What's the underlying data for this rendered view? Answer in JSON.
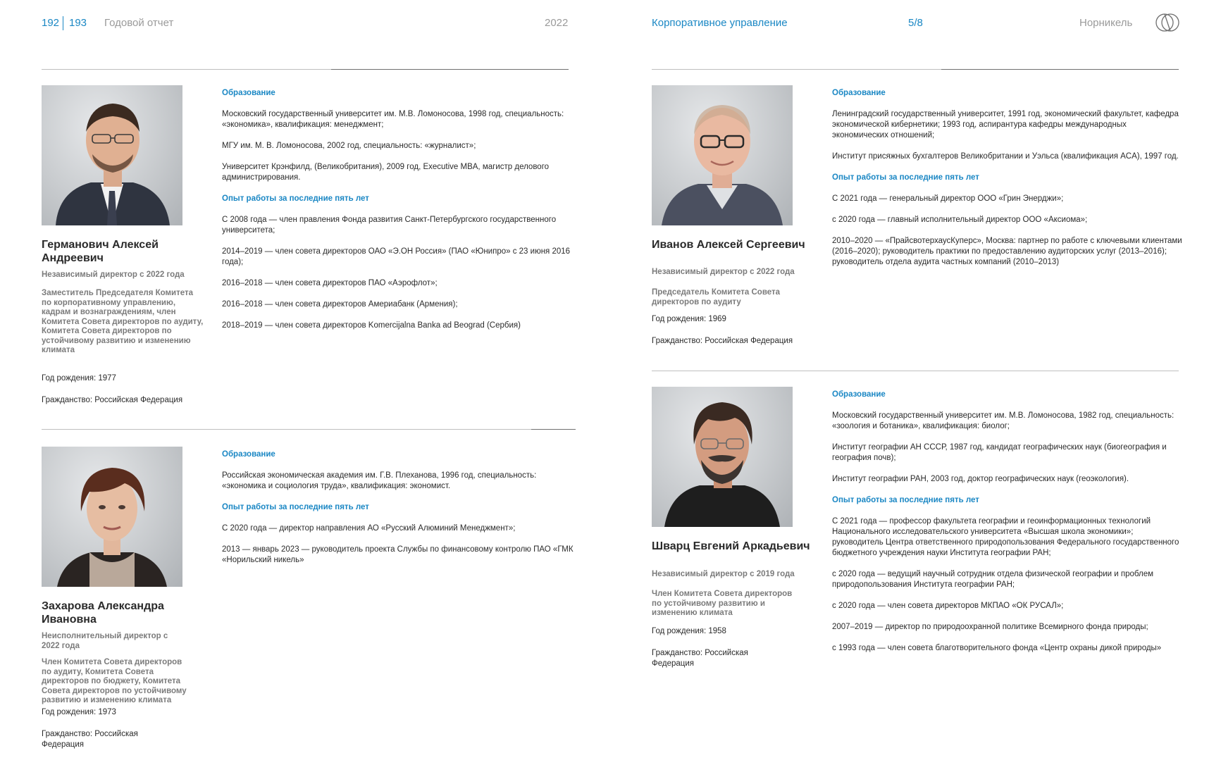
{
  "header": {
    "page_left": "192",
    "page_right": "193",
    "report_title": "Годовой отчет",
    "year": "2022",
    "section": "Корпоративное управление",
    "section_progress": "5/8",
    "company": "Норникель",
    "logo_icon": "nornickel-logo-icon"
  },
  "colors": {
    "accent": "#1a87c4",
    "text": "#2a2a2a",
    "muted": "#7b7b7b",
    "header_muted": "#9a9a9a"
  },
  "directors": [
    {
      "name": "Германович Алексей Андреевич",
      "role": "Независимый директор с 2022 года",
      "committees": "Заместитель Председателя Комитета по корпоративному управлению, кадрам и вознаграждениям, член Комитета Совета директоров по аудиту, Комитета Совета директоров по устойчивому развитию и изменению климата",
      "birth": "Год рождения: 1977",
      "citizenship": "Гражданство: Российская Федерация",
      "education_heading": "Образование",
      "education": [
        "Московский государственный университет им. М.В. Ломоносова, 1998 год, специальность: «экономика», квалификация: менеджмент;",
        "МГУ им. М. В. Ломоносова, 2002 год, специальность: «журналист»;",
        "Университет Крэнфилд, (Великобритания), 2009 год, Executive MBA, магистр делового администрирования."
      ],
      "experience_heading": "Опыт работы за последние пять лет",
      "experience": [
        "С 2008 года — член правления Фонда развития Санкт-Петербургского государственного университета;",
        "2014–2019 — член совета директоров ОАО «Э.ОН Россия» (ПАО «Юнипро» с 23 июня 2016 года);",
        "2016–2018 — член совета директоров ПАО «Аэрофлот»;",
        "2016–2018 — член совета директоров Америабанк (Армения);",
        "2018–2019 — член совета директоров Komercijalna Banka ad Beograd (Сербия)"
      ]
    },
    {
      "name": "Захарова Александра Ивановна",
      "role": "Неисполнительный директор с 2022 года",
      "committees": "Член Комитета Совета директоров по аудиту, Комитета Совета директоров по бюджету, Комитета Совета директоров по устойчивому развитию и изменению климата",
      "birth": "Год рождения: 1973",
      "citizenship": "Гражданство: Российская Федерация",
      "education_heading": "Образование",
      "education": [
        "Российская экономическая академия им. Г.В. Плеханова, 1996 год, специальность: «экономика и социология труда», квалификация: экономист."
      ],
      "experience_heading": "Опыт работы за последние пять лет",
      "experience": [
        "С 2020 года — директор направления АО «Русский Алюминий Менеджмент»;",
        "2013 — январь 2023 — руководитель проекта Службы по финансовому контролю ПАО «ГМК «Норильский никель»"
      ]
    },
    {
      "name": "Иванов Алексей Сергеевич",
      "role": "Независимый директор с 2022 года",
      "committees": "Председатель Комитета Совета директоров по аудиту",
      "birth": "Год рождения: 1969",
      "citizenship": "Гражданство: Российская Федерация",
      "education_heading": "Образование",
      "education": [
        "Ленинградский государственный университет, 1991 год, экономический факультет, кафедра экономической кибернетики; 1993 год, аспирантура кафедры международных экономических отношений;",
        "Институт присяжных бухгалтеров Великобритании и Уэльса (квалификация ACA), 1997 год."
      ],
      "experience_heading": "Опыт работы за последние пять лет",
      "experience": [
        "С 2021 года — генеральный директор ООО «Грин Энерджи»;",
        "с 2020 года — главный исполнительный директор ООО «Аксиома»;",
        "2010–2020 — «ПрайсвотерхаусКуперс», Москва: партнер по работе с ключевыми клиентами (2016–2020); руководитель практики по предоставлению аудиторских услуг (2013–2016); руководитель отдела аудита частных компаний (2010–2013)"
      ]
    },
    {
      "name": "Шварц Евгений Аркадьевич",
      "role": "Независимый директор с 2019 года",
      "committees": "Член Комитета Совета директоров по устойчивому развитию и изменению климата",
      "birth": "Год рождения: 1958",
      "citizenship": "Гражданство: Российская Федерация",
      "education_heading": "Образование",
      "education": [
        "Московский государственный университет им. М.В. Ломоносова, 1982 год, специальность: «зоология и ботаника», квалификация: биолог;",
        "Институт географии АН СССР, 1987 год, кандидат географических наук (биогеография и география почв);",
        "Институт географии РАН, 2003 год, доктор географических наук (геоэкология)."
      ],
      "experience_heading": "Опыт работы за последние пять лет",
      "experience": [
        "С 2021 года — профессор факультета географии и геоинформационных технологий Национального исследовательского университета «Высшая школа экономики»; руководитель Центра ответственного природопользования Федерального государственного бюджетного учреждения науки Института географии РАН;",
        "с 2020 года — ведущий научный сотрудник отдела физической географии и проблем природопользования Института географии РАН;",
        "с 2020 года — член совета директоров МКПАО «ОК РУСАЛ»;",
        "2007–2019 — директор по природоохранной политике Всемирного фонда природы;",
        "с 1993 года — член совета благотворительного фонда «Центр охраны дикой природы»"
      ]
    }
  ]
}
